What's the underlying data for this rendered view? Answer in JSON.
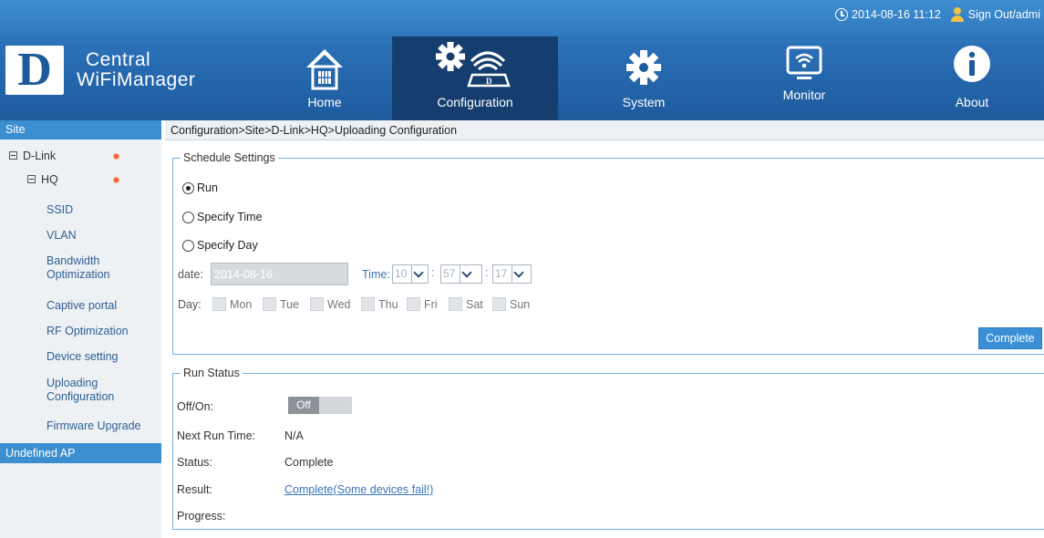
{
  "header": {
    "datetime": "2014-08-16 11:12",
    "signout": "Sign Out/admi",
    "logo_letter": "D",
    "logo_line1": "Central",
    "logo_line2": "WiFiManager",
    "nav": [
      {
        "label": "Home",
        "icon": "home-icon"
      },
      {
        "label": "Configuration",
        "icon": "configuration-icon",
        "active": true
      },
      {
        "label": "System",
        "icon": "gear-icon"
      },
      {
        "label": "Monitor",
        "icon": "monitor-icon"
      },
      {
        "label": "About",
        "icon": "info-icon"
      }
    ]
  },
  "sidebar": {
    "title": "Site",
    "items": [
      {
        "label": "D-Link"
      },
      {
        "label": "HQ"
      },
      {
        "label": "SSID"
      },
      {
        "label": "VLAN"
      },
      {
        "label": "Bandwidth",
        "label2": "Optimization"
      },
      {
        "label": "Captive portal"
      },
      {
        "label": "RF Optimization"
      },
      {
        "label": "Device setting"
      },
      {
        "label": "Uploading",
        "label2": "Configuration"
      },
      {
        "label": "Firmware Upgrade"
      }
    ],
    "undefined_ap": "Undefined AP"
  },
  "breadcrumb": "Configuration>Site>D-Link>HQ>Uploading Configuration",
  "schedule": {
    "legend": "Schedule Settings",
    "radios": [
      {
        "label": "Run",
        "checked": true
      },
      {
        "label": "Specify Time",
        "checked": false
      },
      {
        "label": "Specify Day",
        "checked": false
      }
    ],
    "date_label": "date:",
    "date_value": "2014-08-16",
    "time_label": "Time:",
    "hour": "10",
    "minute": "57",
    "second": "17",
    "colon": ":",
    "day_label": "Day:",
    "days": [
      "Mon",
      "Tue",
      "Wed",
      "Thu",
      "Fri",
      "Sat",
      "Sun"
    ],
    "complete_button": "Complete"
  },
  "run_status": {
    "legend": "Run Status",
    "offon_label": "Off/On:",
    "toggle_value": "Off",
    "next_run_label": "Next Run Time:",
    "next_run_value": "N/A",
    "status_label": "Status:",
    "status_value": "Complete",
    "result_label": "Result:",
    "result_value": "Complete(Some devices fail!)",
    "progress_label": "Progress:"
  }
}
